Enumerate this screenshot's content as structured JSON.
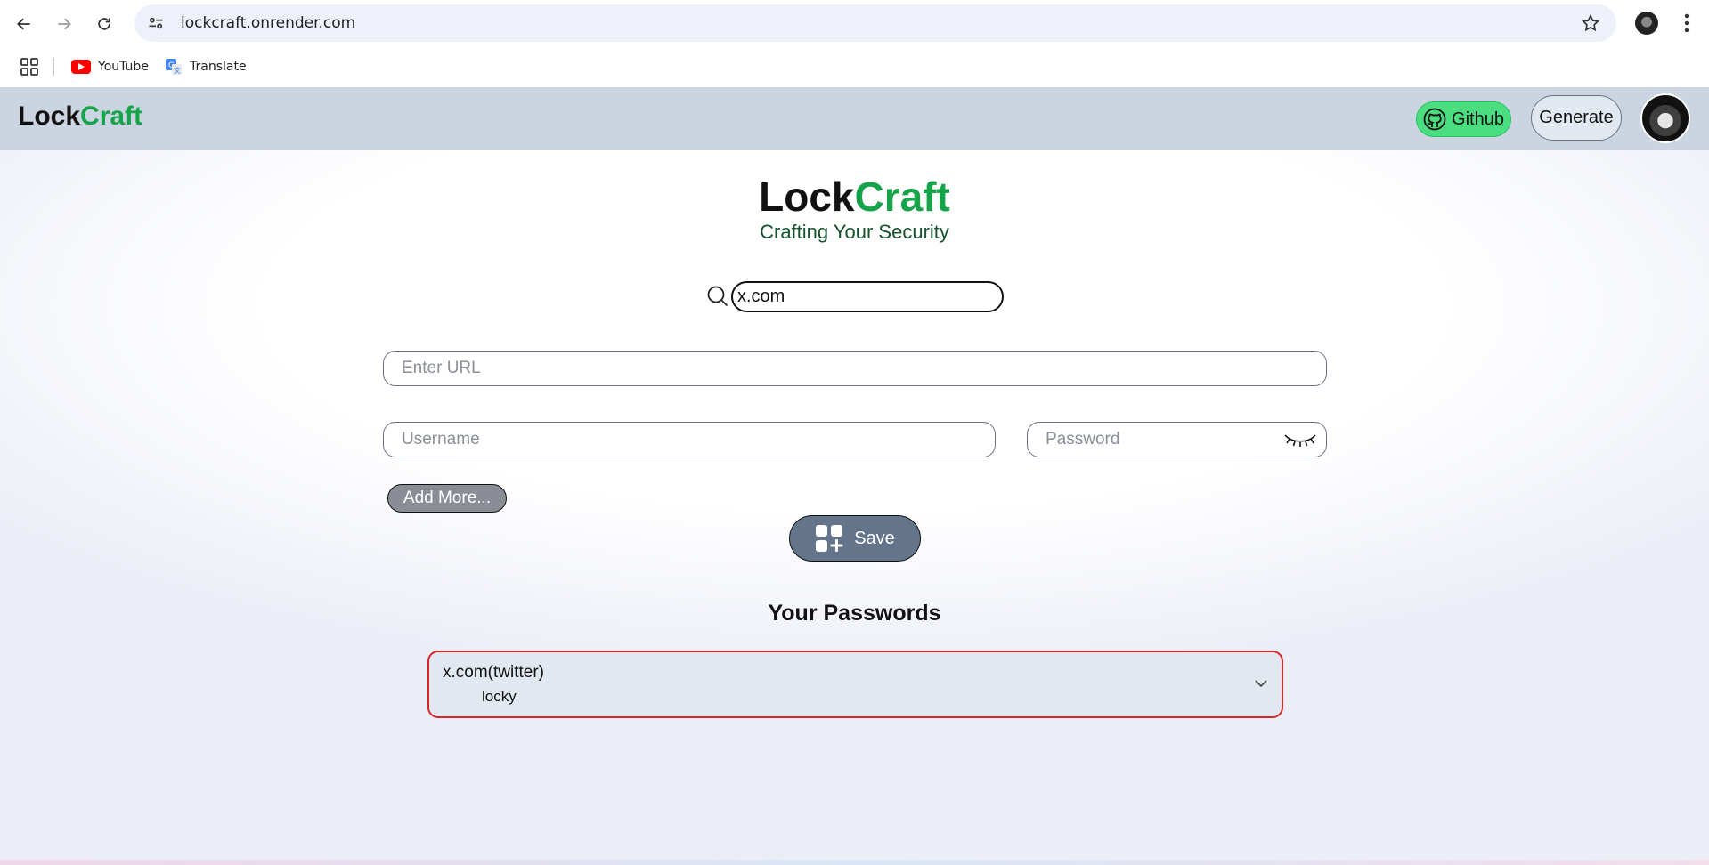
{
  "browser": {
    "url": "lockcraft.onrender.com",
    "bookmarks": [
      {
        "label": "YouTube",
        "icon": "youtube-icon"
      },
      {
        "label": "Translate",
        "icon": "translate-icon"
      }
    ]
  },
  "navbar": {
    "logo_part1": "Lock",
    "logo_part2": "Craft",
    "github_label": "Github",
    "generate_label": "Generate"
  },
  "hero": {
    "title_part1": "Lock",
    "title_part2": "Craft",
    "subtitle": "Crafting Your Security"
  },
  "search": {
    "value": "x.com"
  },
  "form": {
    "url_placeholder": "Enter URL",
    "username_placeholder": "Username",
    "password_placeholder": "Password",
    "add_more_label": "Add More...",
    "save_label": "Save"
  },
  "passwords": {
    "title": "Your Passwords",
    "items": [
      {
        "site": "x.com(twitter)",
        "username": "locky"
      }
    ]
  },
  "colors": {
    "brand_green": "#16a34a",
    "navbar_bg": "#cbd5e1",
    "github_btn": "#4ade80",
    "save_btn": "#64748b",
    "card_border": "#dc2626"
  }
}
